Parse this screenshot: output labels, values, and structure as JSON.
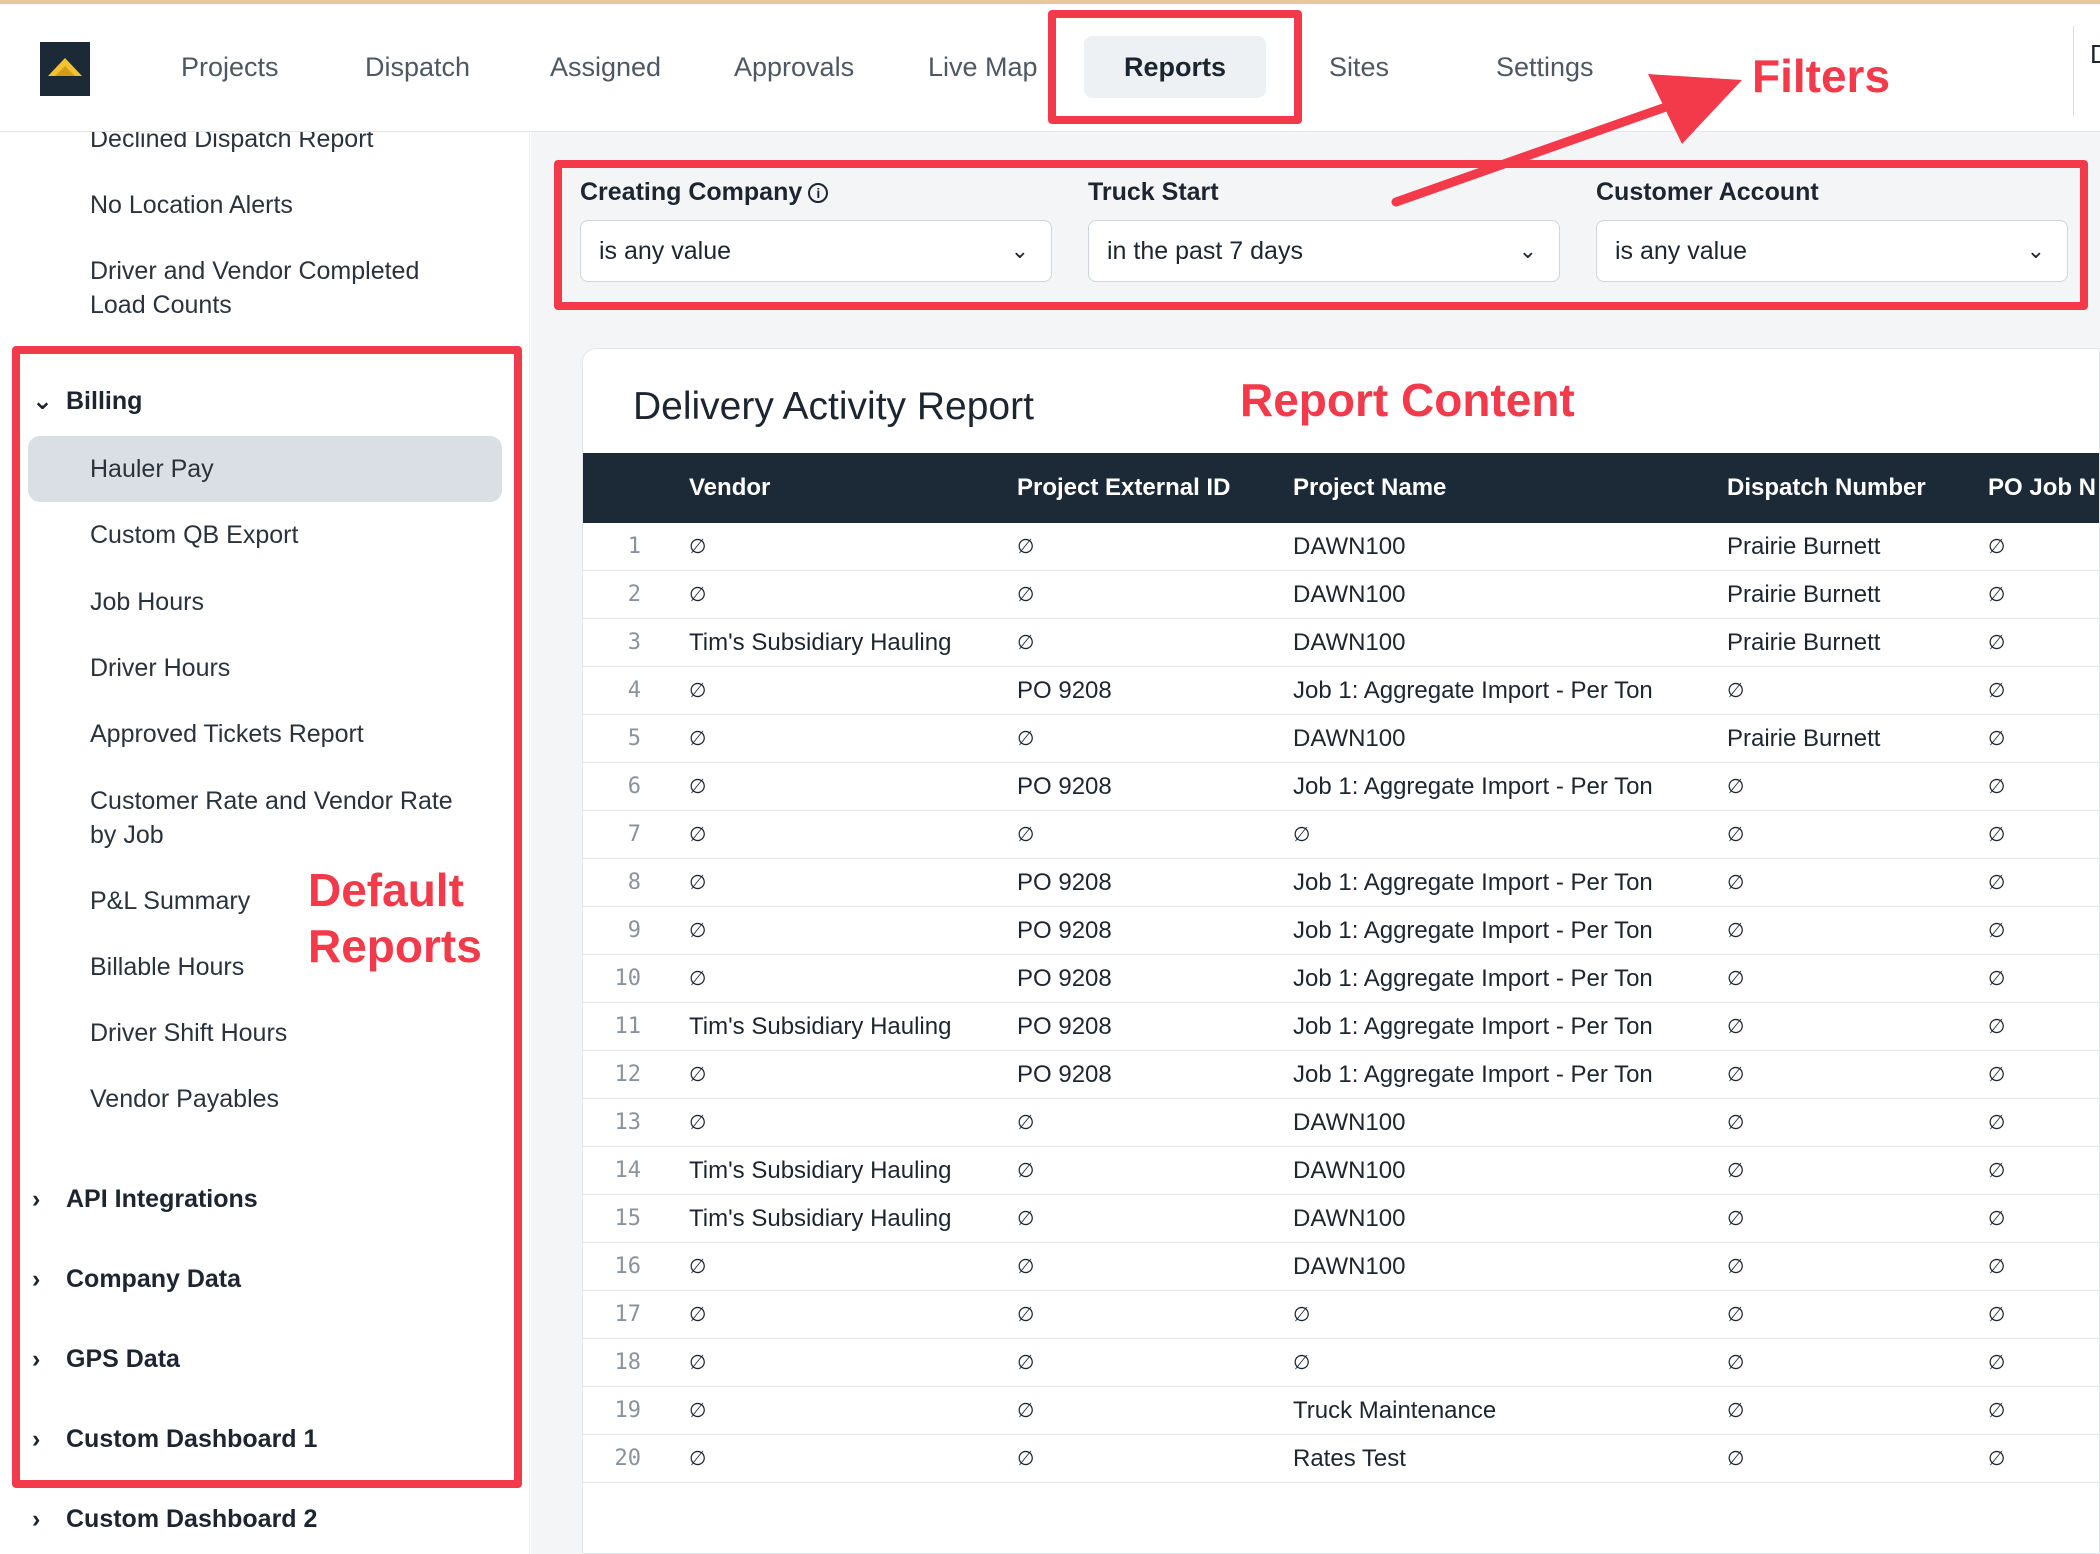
{
  "nav": {
    "items": [
      "Projects",
      "Dispatch",
      "Assigned",
      "Approvals",
      "Live Map",
      "Reports",
      "Sites",
      "Settings"
    ],
    "active": "Reports",
    "right_text": "D"
  },
  "sidebar": {
    "top_items": [
      "Declined Dispatch Report",
      "No Location Alerts",
      "Driver and Vendor Completed",
      "Load Counts"
    ],
    "billing_group": "Billing",
    "billing_items": [
      "Hauler Pay",
      "Custom QB Export",
      "Job Hours",
      "Driver Hours",
      "Approved Tickets Report",
      "Customer Rate and Vendor Rate",
      "by Job",
      "P&L Summary",
      "Billable Hours",
      "Driver Shift Hours",
      "Vendor Payables"
    ],
    "selected_item": "Hauler Pay",
    "collapsed_groups": [
      "API Integrations",
      "Company Data",
      "GPS Data",
      "Custom Dashboard 1",
      "Custom Dashboard 2"
    ]
  },
  "filters": [
    {
      "label": "Creating Company",
      "value": "is any value",
      "has_info": true
    },
    {
      "label": "Truck Start",
      "value": "in the past 7 days",
      "has_info": false
    },
    {
      "label": "Customer Account",
      "value": "is any value",
      "has_info": false
    }
  ],
  "report": {
    "title": "Delivery Activity Report",
    "columns": [
      "Vendor",
      "Project External ID",
      "Project Name",
      "Dispatch Number",
      "PO Job N"
    ],
    "null_symbol": "∅",
    "rows": [
      [
        "1",
        "∅",
        "∅",
        "DAWN100",
        "Prairie Burnett",
        "∅"
      ],
      [
        "2",
        "∅",
        "∅",
        "DAWN100",
        "Prairie Burnett",
        "∅"
      ],
      [
        "3",
        "Tim's Subsidiary Hauling",
        "∅",
        "DAWN100",
        "Prairie Burnett",
        "∅"
      ],
      [
        "4",
        "∅",
        "PO 9208",
        "Job 1: Aggregate Import - Per Ton",
        "∅",
        "∅"
      ],
      [
        "5",
        "∅",
        "∅",
        "DAWN100",
        "Prairie Burnett",
        "∅"
      ],
      [
        "6",
        "∅",
        "PO 9208",
        "Job 1: Aggregate Import - Per Ton",
        "∅",
        "∅"
      ],
      [
        "7",
        "∅",
        "∅",
        "∅",
        "∅",
        "∅"
      ],
      [
        "8",
        "∅",
        "PO 9208",
        "Job 1: Aggregate Import - Per Ton",
        "∅",
        "∅"
      ],
      [
        "9",
        "∅",
        "PO 9208",
        "Job 1: Aggregate Import - Per Ton",
        "∅",
        "∅"
      ],
      [
        "10",
        "∅",
        "PO 9208",
        "Job 1: Aggregate Import - Per Ton",
        "∅",
        "∅"
      ],
      [
        "11",
        "Tim's Subsidiary Hauling",
        "PO 9208",
        "Job 1: Aggregate Import - Per Ton",
        "∅",
        "∅"
      ],
      [
        "12",
        "∅",
        "PO 9208",
        "Job 1: Aggregate Import - Per Ton",
        "∅",
        "∅"
      ],
      [
        "13",
        "∅",
        "∅",
        "DAWN100",
        "∅",
        "∅"
      ],
      [
        "14",
        "Tim's Subsidiary Hauling",
        "∅",
        "DAWN100",
        "∅",
        "∅"
      ],
      [
        "15",
        "Tim's Subsidiary Hauling",
        "∅",
        "DAWN100",
        "∅",
        "∅"
      ],
      [
        "16",
        "∅",
        "∅",
        "DAWN100",
        "∅",
        "∅"
      ],
      [
        "17",
        "∅",
        "∅",
        "∅",
        "∅",
        "∅"
      ],
      [
        "18",
        "∅",
        "∅",
        "∅",
        "∅",
        "∅"
      ],
      [
        "19",
        "∅",
        "∅",
        "Truck Maintenance",
        "∅",
        "∅"
      ],
      [
        "20",
        "∅",
        "∅",
        "Rates Test",
        "∅",
        "∅"
      ]
    ]
  },
  "annotations": {
    "filters": "Filters",
    "report_content": "Report Content",
    "default_reports_line1": "Default",
    "default_reports_line2": "Reports",
    "color": "#f23a4a"
  },
  "colors": {
    "table_header_bg": "#1b2a36",
    "selected_item_bg": "#d9dfe4",
    "active_tab_bg": "#eef1f4"
  },
  "icons": {
    "logo": "mountain-logo-icon",
    "expand": "chevron-down-icon",
    "collapse": "chevron-right-icon",
    "dropdown": "chevron-down-icon",
    "info": "info-icon"
  }
}
